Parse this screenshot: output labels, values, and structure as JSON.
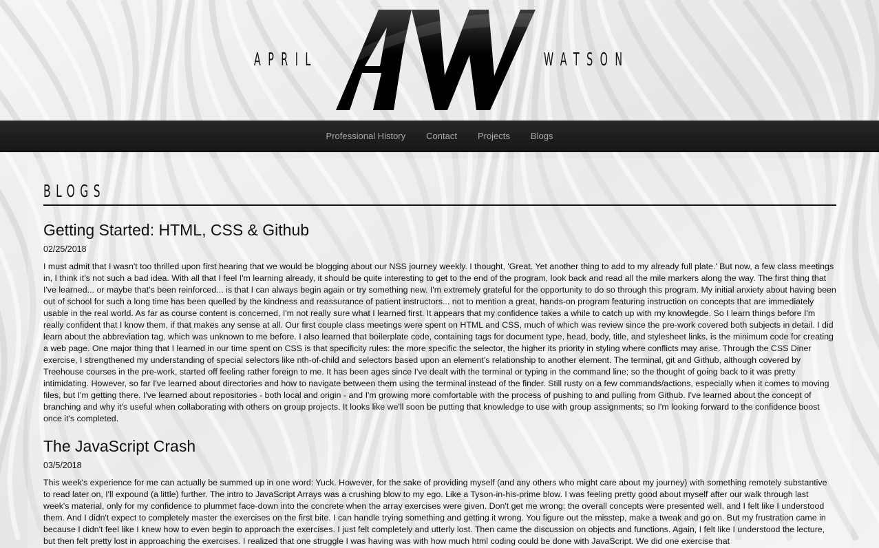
{
  "header": {
    "logo_left": "APRIL",
    "logo_right": "WATSON",
    "logo_mark": "AW"
  },
  "nav": {
    "items": [
      {
        "label": "Professional History"
      },
      {
        "label": "Contact"
      },
      {
        "label": "Projects"
      },
      {
        "label": "Blogs"
      }
    ]
  },
  "page": {
    "title": "BLOGS"
  },
  "posts": [
    {
      "title": "Getting Started: HTML, CSS & Github",
      "date": "02/25/2018",
      "body": "I must admit that I wasn't too thrilled upon first hearing that we would be blogging about our NSS journey weekly. I thought, 'Great. Yet another thing to add to my already full plate.' But now, a few class meetings in, I think it's not such a bad idea. With all that I feel I'm learning already, it should be quite interesting to get to the end of the program, look back and read all the mile markers along the way. The first thing that I've learned... or maybe that's been reinforced... is that I can always begin again or try something new. I'm extremely grateful for the opportunity to do so through this program. My initial anxiety about having been out of school for such a long time has been quelled by the kindness and reassurance of patient instructors... not to mention a great, hands-on program featuring instruction on concepts that are immediately usable in the real world. As far as course content is concerned, I'm not really sure what I learned first. It appears that my confidence takes a while to catch up with my knowlegde. So I learn things before I'm really confident that I know them, if that makes any sense at all. Our first couple class meetings were spent on HTML and CSS, much of which was review since the pre-work covered both subjects in detail. I did learn about the abbreviation tag, which was unknown to me before. I also learned that boilerplate code, containing tags for document type, head, body, title, and stylesheet links, is the minimum code for creating a web page. One major thing that I learned in our time spent on CSS is that specificity rules: the more specific the selector, the higher its priority in styling where conflicts may arise. Through the CSS Diner exercise, I strengthened my understanding of special selectors like nth-of-child and selectors based upon an element's relationship to another element. The terminal, git and Github, although covered by Treehouse courses in the pre-work, started off feeling rather foreign to me. It has been ages since I've dealt with the terminal or typing in the command line; so the thought of going back to it was pretty intimidating. However, so far I've learned about directories and how to navigate between them using the terminal instead of the finder. Still rusty on a few commands/actions, especially when it comes to moving files, but I'm getting there. I've learned about repositories - both local and origin - and I'm growing more comfortable with the process of pushing to and pulling from Github. I've learned about the concept of branching and why it's useful when collaborating with others on group projects. It looks like we'll soon be putting that knowledge to use with group assignments; so I'm looking forward to the confidence boost once it's completed."
    },
    {
      "title": "The JavaScript Crash",
      "date": "03/5/2018",
      "body": "This week's experience for me can actually be summed up in one word: Yuck. However, for the sake of providing myself (and any others who might care about my journey) with something remotely substantive to read later on, I'll expound (a little) further. The intro to JavaScript Arrays was a crushing blow to my ego. Like a Tyson-in-his-prime blow. I was feeling pretty good about myself after our walk through last week's material, only for my confidence to plummet face-down into the concrete when the array exercises were given. Don't get me wrong: the overall concepts were presented well, and I felt like I understood them. And I didn't expect to completely master the exercises on the first bite. I can handle trying something and getting it wrong. You figure out the misstep, make a tweak and go on. But my frustration came in because I didn't feel like I knew how to even begin to approach the exercises. I just felt completely and utterly lost. Then came the discussion on objects and functions. Again, I felt like I understood the lecture, but then felt pretty lost in approaching the exercises. I realized that one struggle I was having was with how much html coding could be done with JavaScript. We did one exercise that"
    }
  ],
  "colors": {
    "nav_bg": "#1c1c1c",
    "nav_text": "#a9a9a9",
    "text": "#111111"
  }
}
